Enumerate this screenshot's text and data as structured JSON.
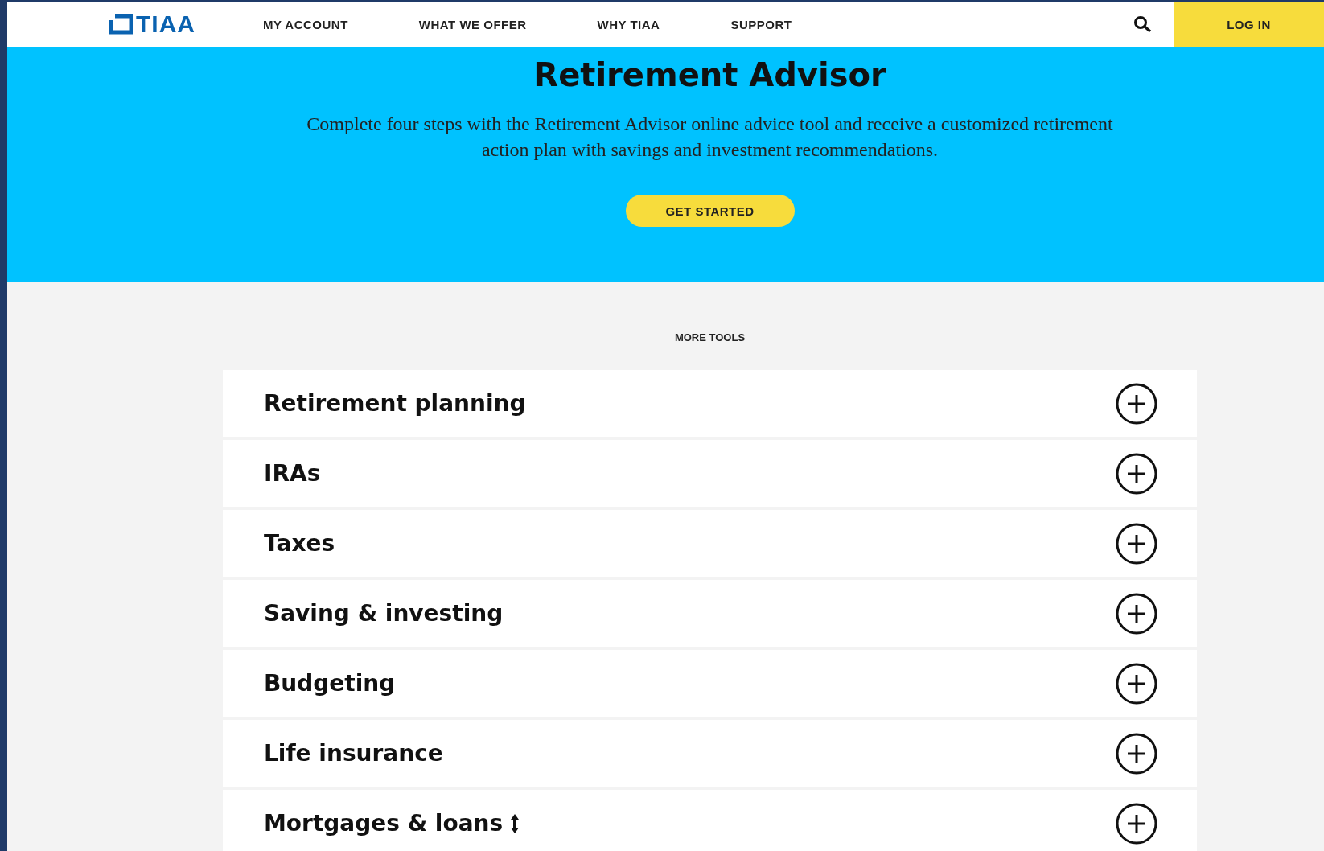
{
  "header": {
    "logo": "TIAA",
    "nav": [
      {
        "label": "MY ACCOUNT"
      },
      {
        "label": "WHAT WE OFFER"
      },
      {
        "label": "WHY TIAA"
      },
      {
        "label": "SUPPORT"
      }
    ],
    "login": "LOG IN"
  },
  "hero": {
    "title": "Retirement Advisor",
    "description": "Complete four steps with the Retirement Advisor online advice tool and receive a customized retirement action plan with savings and investment recommendations.",
    "button": "GET STARTED"
  },
  "more_tools": {
    "heading": "MORE TOOLS",
    "items": [
      {
        "label": "Retirement planning",
        "expanded": false
      },
      {
        "label": "IRAs",
        "expanded": false
      },
      {
        "label": "Taxes",
        "expanded": false
      },
      {
        "label": "Saving & investing",
        "expanded": false
      },
      {
        "label": "Budgeting",
        "expanded": false
      },
      {
        "label": "Life insurance",
        "expanded": false
      },
      {
        "label": "Mortgages & loans",
        "expanded": false,
        "cursor": true
      }
    ]
  }
}
